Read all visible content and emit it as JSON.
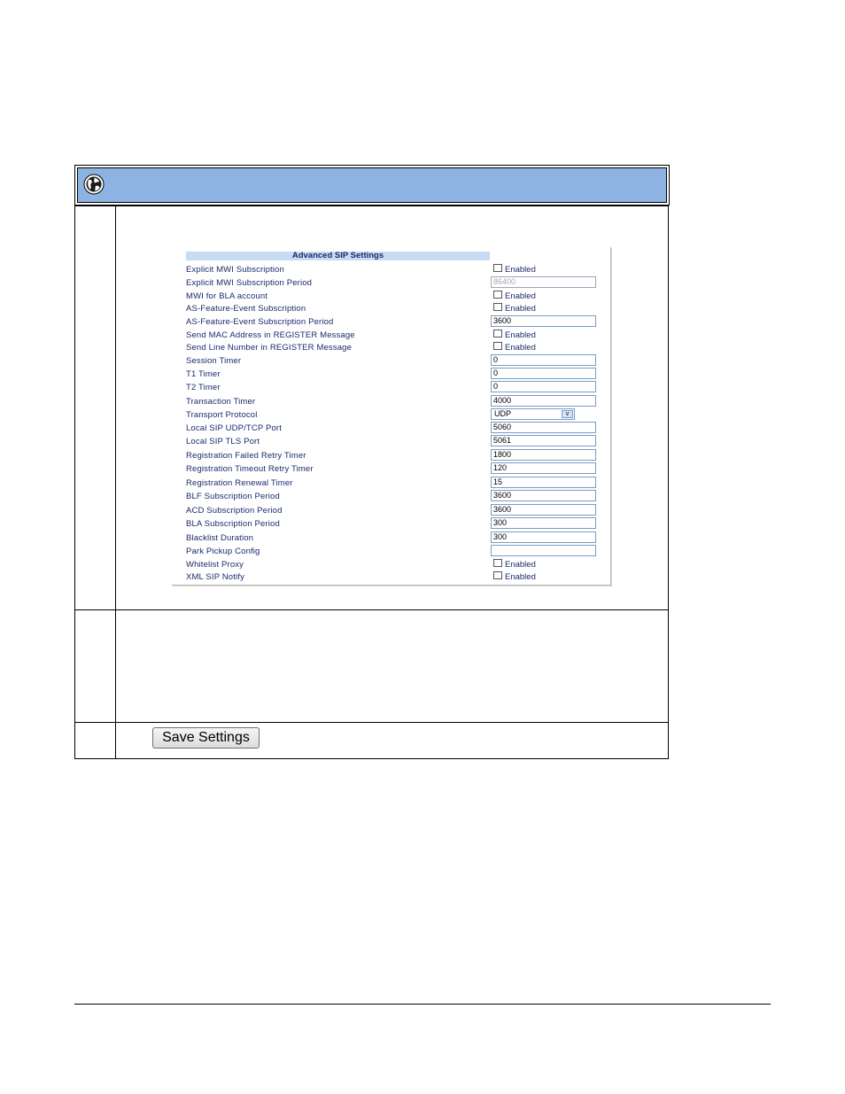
{
  "header": {
    "icon": "globe-icon",
    "bar_color": "#8db3e2"
  },
  "panel": {
    "title": "Advanced SIP Settings",
    "rows": [
      {
        "label": "Explicit MWI Subscription",
        "type": "checkbox",
        "value": "Enabled",
        "checked": false
      },
      {
        "label": "Explicit MWI Subscription Period",
        "type": "input",
        "value": "86400",
        "disabled": true
      },
      {
        "label": "MWI for BLA account",
        "type": "checkbox",
        "value": "Enabled",
        "checked": false
      },
      {
        "label": "AS-Feature-Event Subscription",
        "type": "checkbox",
        "value": "Enabled",
        "checked": false
      },
      {
        "label": "AS-Feature-Event Subscription Period",
        "type": "input",
        "value": "3600"
      },
      {
        "label": "Send MAC Address in REGISTER Message",
        "type": "checkbox",
        "value": "Enabled",
        "checked": false
      },
      {
        "label": "Send Line Number in REGISTER Message",
        "type": "checkbox",
        "value": "Enabled",
        "checked": false
      },
      {
        "label": "Session Timer",
        "type": "input",
        "value": "0"
      },
      {
        "label": "T1 Timer",
        "type": "input",
        "value": "0"
      },
      {
        "label": "T2 Timer",
        "type": "input",
        "value": "0"
      },
      {
        "label": "Transaction Timer",
        "type": "input",
        "value": "4000"
      },
      {
        "label": "Transport Protocol",
        "type": "select",
        "value": "UDP"
      },
      {
        "label": "Local SIP UDP/TCP Port",
        "type": "input",
        "value": "5060"
      },
      {
        "label": "Local SIP TLS Port",
        "type": "input",
        "value": "5061"
      },
      {
        "label": "Registration Failed Retry Timer",
        "type": "input",
        "value": "1800"
      },
      {
        "label": "Registration Timeout Retry Timer",
        "type": "input",
        "value": "120"
      },
      {
        "label": "Registration Renewal Timer",
        "type": "input",
        "value": "15"
      },
      {
        "label": "BLF Subscription Period",
        "type": "input",
        "value": "3600"
      },
      {
        "label": "ACD Subscription Period",
        "type": "input",
        "value": "3600"
      },
      {
        "label": "BLA Subscription Period",
        "type": "input",
        "value": "300"
      },
      {
        "label": "Blacklist Duration",
        "type": "input",
        "value": "300"
      },
      {
        "label": "Park Pickup Config",
        "type": "input",
        "value": ""
      },
      {
        "label": "Whitelist Proxy",
        "type": "checkbox",
        "value": "Enabled",
        "checked": false
      },
      {
        "label": "XML SIP Notify",
        "type": "checkbox",
        "value": "Enabled",
        "checked": false
      }
    ]
  },
  "save_button": {
    "label": "Save Settings"
  }
}
